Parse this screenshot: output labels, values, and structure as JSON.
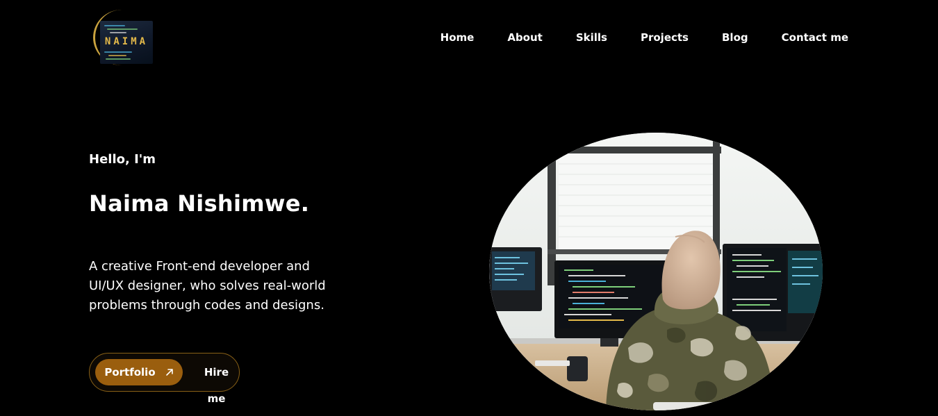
{
  "brand": {
    "logo_text": "NAIMA",
    "logo_alt": "Naima logo"
  },
  "nav": {
    "items": [
      {
        "label": "Home"
      },
      {
        "label": "About"
      },
      {
        "label": "Skills"
      },
      {
        "label": "Projects"
      },
      {
        "label": "Blog"
      },
      {
        "label": "Contact me"
      }
    ]
  },
  "hero": {
    "greeting": "Hello, I'm",
    "name": "Naima Nishimwe.",
    "description": "A creative Front-end developer and UI/UX designer, who solves real-world problems through codes and designs.",
    "portfolio_label": "Portfolio",
    "hire_label": "Hire me",
    "photo_alt": "Developer working at computer monitors"
  },
  "icons": {
    "portfolio_arrow": "arrow-up-right-icon"
  },
  "colors": {
    "background": "#000000",
    "text": "#ffffff",
    "accent": "#9a5e0e",
    "accent_border": "#8a6116",
    "logo_gold": "#e3b94a"
  }
}
